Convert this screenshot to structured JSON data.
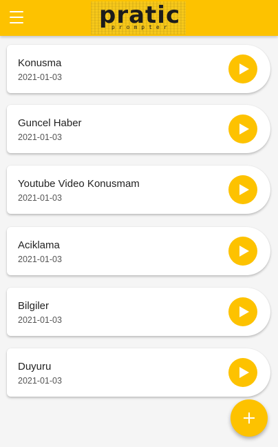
{
  "app": {
    "logo_text": "pratic",
    "logo_subtext": "prompter"
  },
  "colors": {
    "accent": "#fdc200",
    "background": "#f5f5f5"
  },
  "icons": {
    "menu": "menu-icon",
    "play": "play-icon",
    "add": "add-icon"
  },
  "items": [
    {
      "title": "Konusma",
      "date": "2021-01-03"
    },
    {
      "title": "Guncel Haber",
      "date": "2021-01-03"
    },
    {
      "title": "Youtube Video Konusmam",
      "date": "2021-01-03"
    },
    {
      "title": "Aciklama",
      "date": "2021-01-03"
    },
    {
      "title": "Bilgiler",
      "date": "2021-01-03"
    },
    {
      "title": "Duyuru",
      "date": "2021-01-03"
    }
  ]
}
